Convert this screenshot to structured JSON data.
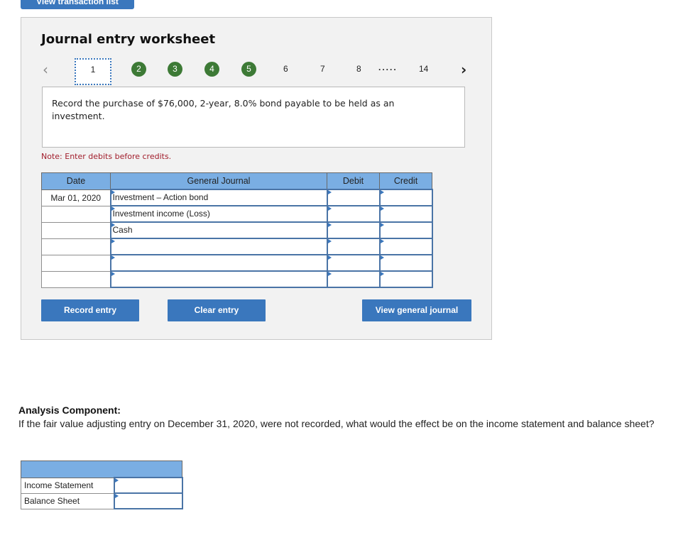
{
  "top_button": {
    "label": "View transaction list"
  },
  "worksheet": {
    "title": "Journal entry worksheet",
    "pager": {
      "prev_icon": "chevron-left-icon",
      "next_icon": "chevron-right-icon",
      "current": "1",
      "completed": [
        "2",
        "3",
        "4",
        "5"
      ],
      "pages": [
        "6",
        "7",
        "8"
      ],
      "ellipsis": ".....",
      "last": "14",
      "completed_color": "#3d7a36"
    },
    "prompt": "Record the purchase of $76,000, 2-year, 8.0% bond payable to be held as an investment.",
    "note": "Note: Enter debits before credits.",
    "table": {
      "headers": {
        "date": "Date",
        "general_journal": "General Journal",
        "debit": "Debit",
        "credit": "Credit"
      },
      "rows": [
        {
          "date": "Mar 01, 2020",
          "account": "Investment – Action bond",
          "debit": "",
          "credit": ""
        },
        {
          "date": "",
          "account": "Investment income (Loss)",
          "debit": "",
          "credit": ""
        },
        {
          "date": "",
          "account": "Cash",
          "debit": "",
          "credit": ""
        },
        {
          "date": "",
          "account": "",
          "debit": "",
          "credit": ""
        },
        {
          "date": "",
          "account": "",
          "debit": "",
          "credit": ""
        },
        {
          "date": "",
          "account": "",
          "debit": "",
          "credit": ""
        }
      ]
    },
    "buttons": {
      "record": "Record entry",
      "clear": "Clear entry",
      "view_journal": "View general journal"
    },
    "accent_color": "#3a77bd"
  },
  "analysis": {
    "title": "Analysis Component:",
    "question": "If the fair value adjusting entry on December 31, 2020, were not recorded, what would the effect be on the income statement and balance sheet?",
    "rows": [
      {
        "label": "Income Statement",
        "value": ""
      },
      {
        "label": "Balance Sheet",
        "value": ""
      }
    ]
  }
}
